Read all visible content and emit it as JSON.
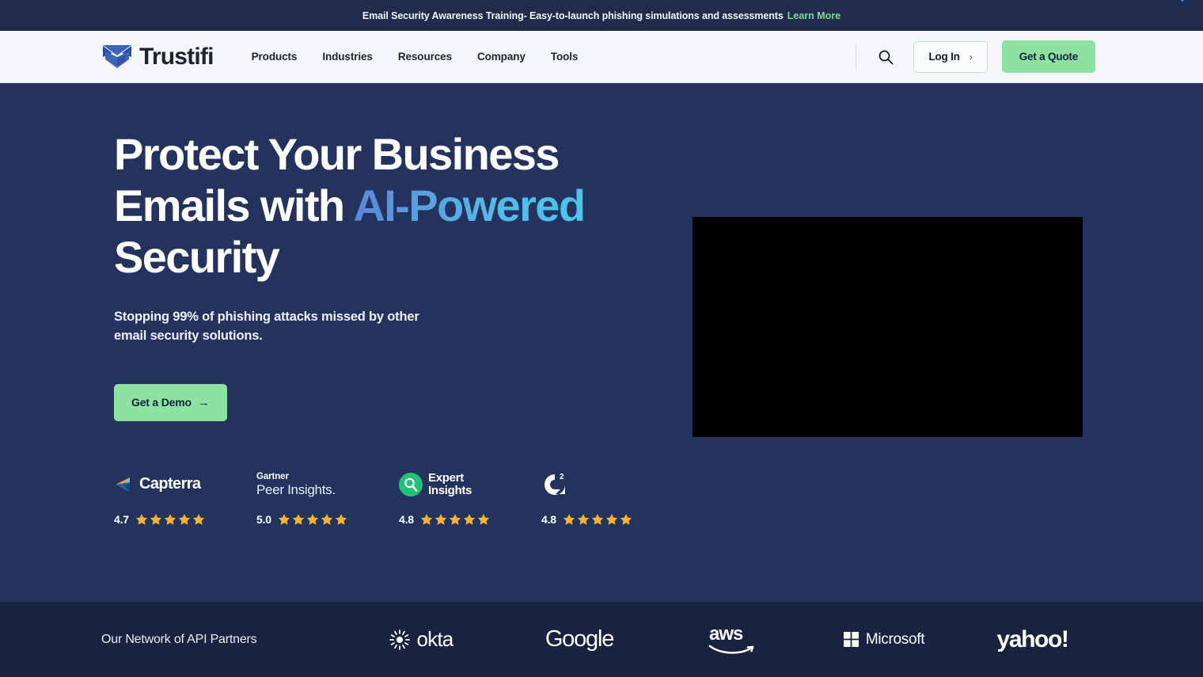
{
  "announcement": {
    "text": "Email Security Awareness Training- Easy-to-launch phishing simulations and assessments",
    "link_label": "Learn More",
    "link_color": "#7fd99a",
    "background": "#212c4d"
  },
  "header": {
    "brand_name": "Trustifi",
    "brand_icon": "trustifi-shield-envelope-icon",
    "background": "#f4f6f9",
    "nav": [
      {
        "label": "Products"
      },
      {
        "label": "Industries"
      },
      {
        "label": "Resources"
      },
      {
        "label": "Company"
      },
      {
        "label": "Tools"
      }
    ],
    "search_icon": "search-icon",
    "login_label": "Log In",
    "login_chevron": "›",
    "quote_label": "Get a Quote",
    "quote_color": "#8ee2a1"
  },
  "hero": {
    "background": "#24335e",
    "title_part1": "Protect Your Business Emails with ",
    "title_accent": "AI-Powered",
    "title_part2": " Security",
    "accent_gradient_from": "#5b86d6",
    "accent_gradient_to": "#49c4ee",
    "subtitle": "Stopping 99% of phishing attacks missed by other email security solutions.",
    "cta_label": "Get a Demo",
    "cta_arrow": "→",
    "cta_color": "#8ee2a1",
    "video_placeholder": "hero-video-player",
    "video_background": "#000000"
  },
  "ratings": {
    "star_color": "#f5b429",
    "items": [
      {
        "source": "Capterra",
        "logo_icon": "capterra-logo-icon",
        "score": "4.7",
        "stars": 5
      },
      {
        "source": "Gartner Peer Insights",
        "logo_icon": "gartner-peer-insights-logo",
        "line1": "Gartner",
        "line2": "Peer Insights.",
        "score": "5.0",
        "stars": 5
      },
      {
        "source": "Expert Insights",
        "logo_icon": "expert-insights-logo-icon",
        "line1": "Expert",
        "line2": "Insights",
        "score": "4.8",
        "stars": 5
      },
      {
        "source": "G2",
        "logo_icon": "g2-logo-icon",
        "score": "4.8",
        "stars": 5
      }
    ]
  },
  "partners": {
    "background": "#19233f",
    "label": "Our Network of API Partners",
    "items": [
      {
        "name": "okta",
        "icon": "okta-burst-icon"
      },
      {
        "name": "Google",
        "icon": "google-wordmark"
      },
      {
        "name": "aws",
        "icon": "aws-smile-icon"
      },
      {
        "name": "Microsoft",
        "icon": "microsoft-squares-icon"
      },
      {
        "name": "yahoo!",
        "icon": "yahoo-wordmark"
      }
    ]
  }
}
